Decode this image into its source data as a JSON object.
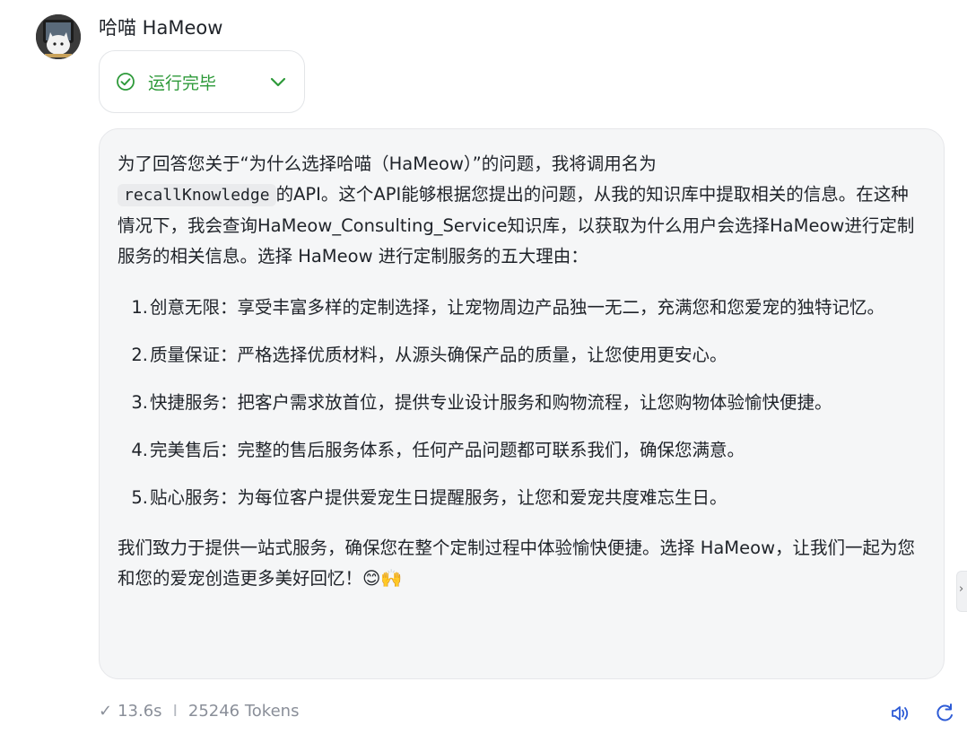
{
  "message": {
    "author": "哈喵 HaMeow",
    "status": {
      "label": "运行完毕",
      "color": "#2e9a3a",
      "icon": "check-circle-icon",
      "toggle_icon": "chevron-down-icon"
    },
    "intro_before_code": "为了回答您关于“为什么选择哈喵（HaMeow）”的问题，我将调用名为",
    "api_name": "recallKnowledge",
    "intro_after_code": "的API。这个API能够根据您提出的问题，从我的知识库中提取相关的信息。在这种情况下，我会查询HaMeow_Consulting_Service知识库，以获取为什么用户会选择HaMeow进行定制服务的相关信息。选择 HaMeow 进行定制服务的五大理由：",
    "reasons": [
      {
        "num": "1.",
        "text": "创意无限：享受丰富多样的定制选择，让宠物周边产品独一无二，充满您和您爱宠的独特记忆。"
      },
      {
        "num": "2.",
        "text": "质量保证：严格选择优质材料，从源头确保产品的质量，让您使用更安心。"
      },
      {
        "num": "3.",
        "text": "快捷服务：把客户需求放首位，提供专业设计服务和购物流程，让您购物体验愉快便捷。"
      },
      {
        "num": "4.",
        "text": "完美售后：完整的售后服务体系，任何产品问题都可联系我们，确保您满意。"
      },
      {
        "num": "5.",
        "text": "贴心服务：为每位客户提供爱宠生日提醒服务，让您和爱宠共度难忘生日。"
      }
    ],
    "outro": "我们致力于提供一站式服务，确保您在整个定制过程中体验愉快便捷。选择 HaMeow，让我们一起为您和您的爱宠创造更多美好回忆！😊🙌"
  },
  "meta": {
    "check_glyph": "✓",
    "duration": "13.6s",
    "separator": "I",
    "tokens": "25246 Tokens"
  },
  "toolbar": {
    "speaker_icon": "speaker-icon",
    "regenerate_icon": "refresh-icon",
    "accent": "#2d5bd6"
  },
  "edge_tab": {
    "glyph": "›"
  }
}
